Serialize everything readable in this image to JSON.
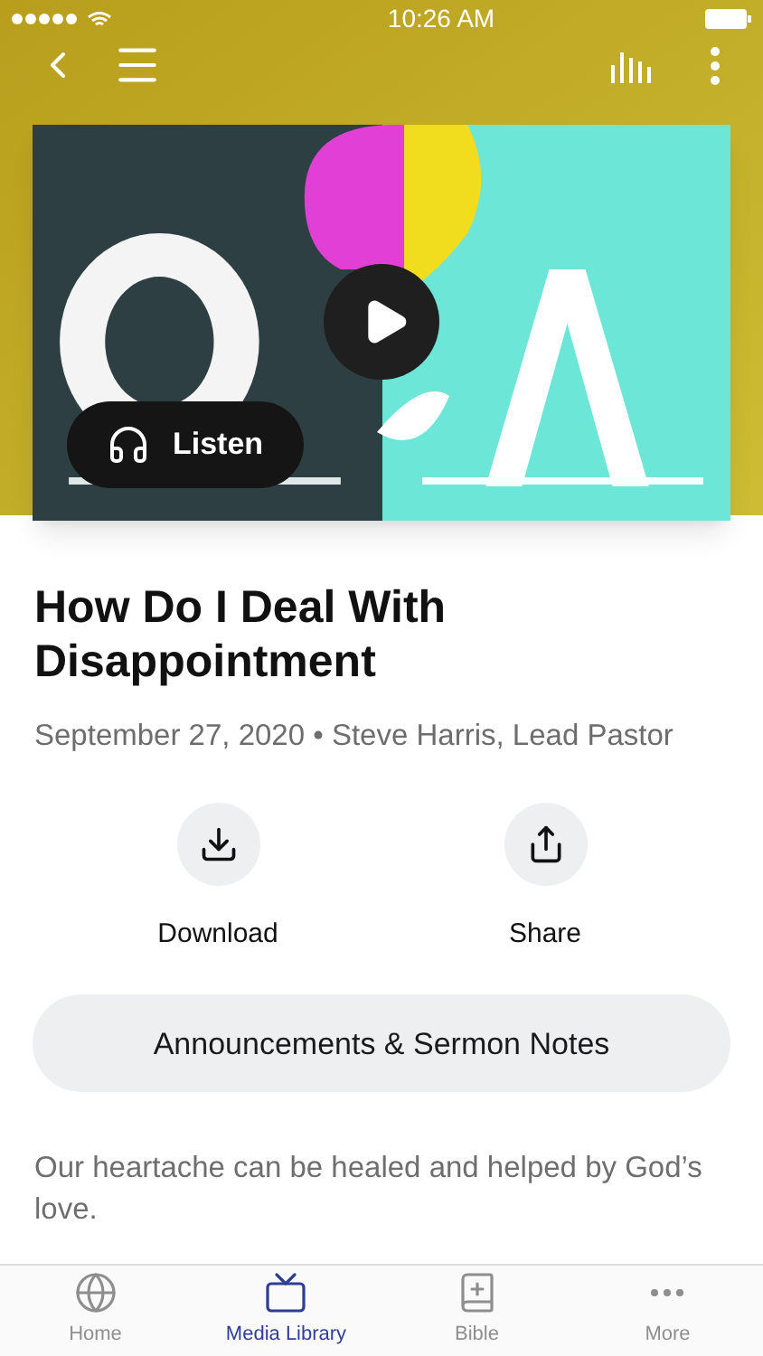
{
  "status_bar": {
    "time": "10:26 AM"
  },
  "media": {
    "listen_label": "Listen"
  },
  "sermon": {
    "title": "How Do I Deal With Disappointment",
    "meta": "September 27, 2020 • Steve Harris, Lead Pastor"
  },
  "actions": [
    {
      "kind": "download",
      "label": "Download"
    },
    {
      "kind": "share",
      "label": "Share"
    }
  ],
  "notes_button": "Announcements & Sermon Notes",
  "description": "Our heartache can be healed and helped by God’s love.",
  "tabs": [
    {
      "kind": "home",
      "label": "Home",
      "selected": false
    },
    {
      "kind": "media",
      "label": "Media Library",
      "selected": true
    },
    {
      "kind": "bible",
      "label": "Bible",
      "selected": false
    },
    {
      "kind": "more",
      "label": "More",
      "selected": false
    }
  ]
}
